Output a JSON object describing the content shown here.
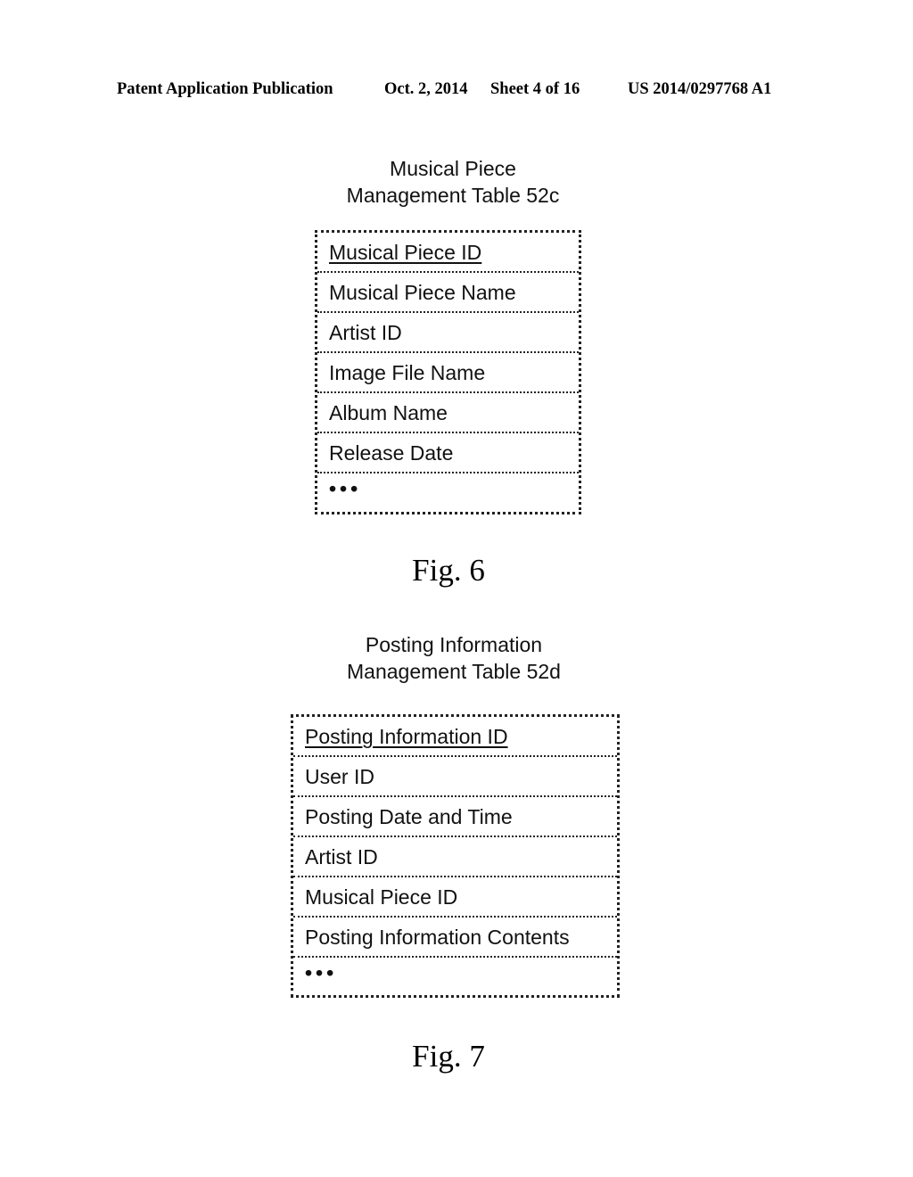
{
  "header": {
    "publication": "Patent Application Publication",
    "date": "Oct. 2, 2014",
    "sheet": "Sheet 4 of 16",
    "number": "US 2014/0297768 A1"
  },
  "fig6": {
    "title_line1": "Musical Piece",
    "title_line2": "Management Table 52c",
    "rows": [
      {
        "label": "Musical Piece ID",
        "key": true
      },
      {
        "label": "Musical Piece Name"
      },
      {
        "label": "Artist ID"
      },
      {
        "label": "Image File Name"
      },
      {
        "label": "Album Name"
      },
      {
        "label": "Release Date"
      },
      {
        "label": "•••"
      }
    ],
    "caption": "Fig. 6"
  },
  "fig7": {
    "title_line1": "Posting Information",
    "title_line2": "Management Table 52d",
    "rows": [
      {
        "label": "Posting Information ID",
        "key": true
      },
      {
        "label": "User ID"
      },
      {
        "label": "Posting Date and Time"
      },
      {
        "label": "Artist ID"
      },
      {
        "label": "Musical Piece ID"
      },
      {
        "label": "Posting Information Contents"
      },
      {
        "label": "•••"
      }
    ],
    "caption": "Fig. 7"
  }
}
